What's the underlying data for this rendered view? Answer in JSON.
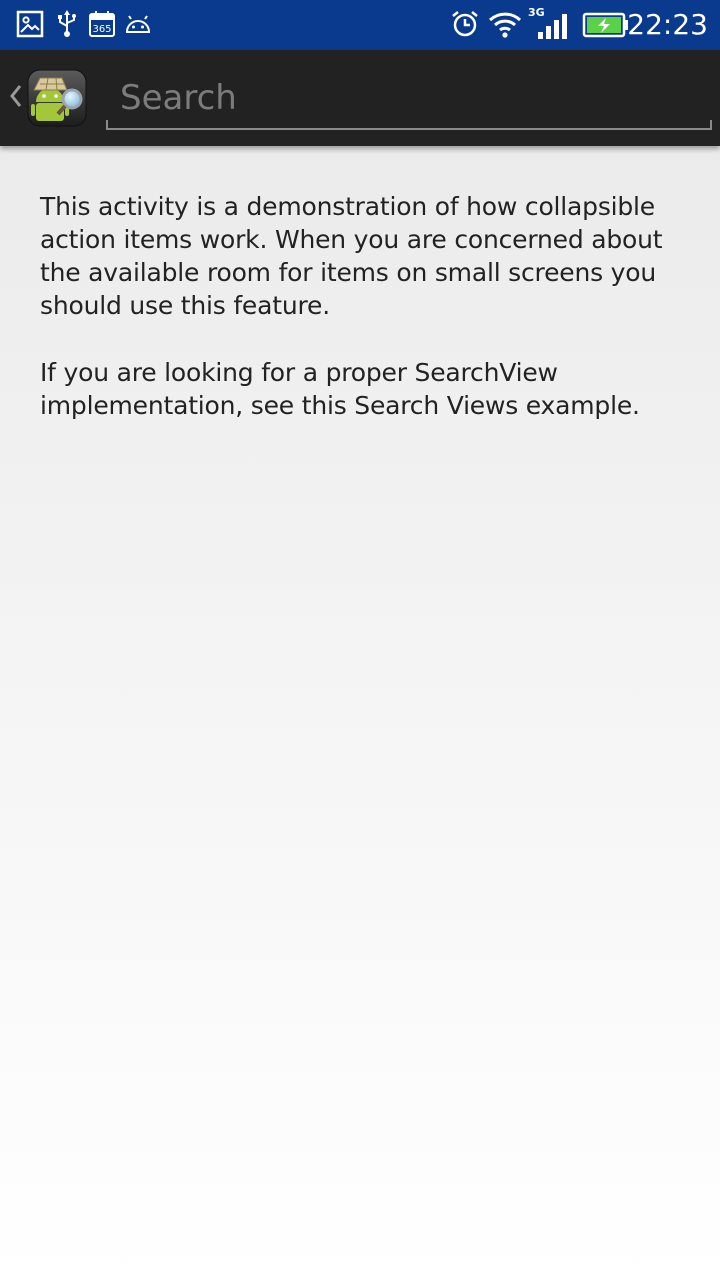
{
  "status_bar": {
    "time": "22:23",
    "network_type": "3G",
    "background_color": "#0a3a8e",
    "left_icons": [
      "image-notification-icon",
      "usb-icon",
      "calendar-365-icon",
      "android-debug-icon"
    ],
    "right_icons": [
      "alarm-icon",
      "wifi-icon",
      "signal-icon",
      "battery-charging-icon"
    ],
    "calendar_label": "365"
  },
  "action_bar": {
    "background_color": "#222222",
    "search": {
      "placeholder": "Search",
      "value": ""
    }
  },
  "content": {
    "paragraph_1": "This activity is a demonstration of how collapsible action items work. When you are concerned about the available room for items on small screens you should use this feature.",
    "paragraph_2": "If you are looking for a proper SearchView implementation, see this Search Views example."
  }
}
